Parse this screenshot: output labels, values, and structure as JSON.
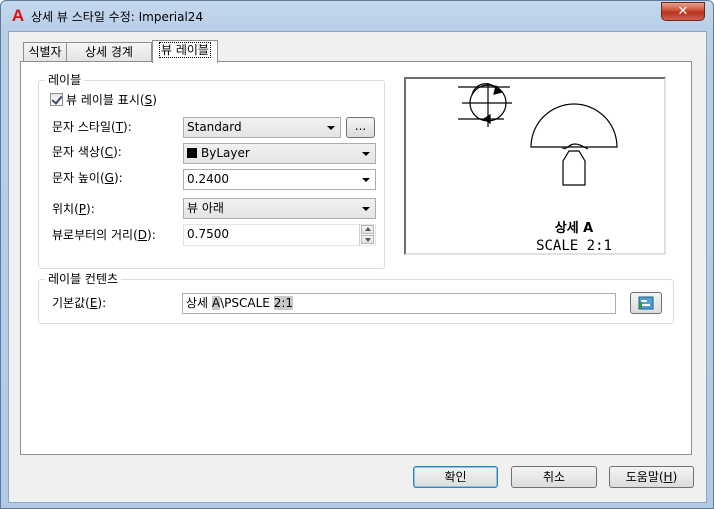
{
  "window": {
    "title": "상세 뷰 스타일 수정: Imperial24",
    "close_glyph": "✕"
  },
  "tabs": [
    {
      "label": "식별자",
      "active": false
    },
    {
      "label": "상세 경계",
      "active": false
    },
    {
      "label": "뷰 레이블",
      "active": true
    }
  ],
  "label_group": {
    "title": "레이블",
    "show_label": {
      "text": "뷰 레이블 표시(",
      "key": "S",
      "suffix": ")",
      "checked": true
    },
    "text_style": {
      "text": "문자 스타일(",
      "key": "T",
      "suffix": "):",
      "value": "Standard",
      "browse_label": "..."
    },
    "text_color": {
      "text": "문자 색상(",
      "key": "C",
      "suffix": "):",
      "value": "ByLayer"
    },
    "text_height": {
      "text": "문자 높이(",
      "key": "G",
      "suffix": "):",
      "value": "0.2400"
    },
    "location": {
      "text": "위치(",
      "key": "P",
      "suffix": "):",
      "value": "뷰 아래"
    },
    "distance": {
      "text": "뷰로부터의 거리(",
      "key": "D",
      "suffix": "):",
      "value": "0.7500"
    }
  },
  "preview": {
    "line1": "상세 A",
    "line2": "SCALE 2:1"
  },
  "content_group": {
    "title": "레이블 컨텐츠",
    "default_label": {
      "text": "기본값(",
      "key": "E",
      "suffix": "):"
    },
    "default_value_parts": [
      {
        "text": "상세 ",
        "highlight": false
      },
      {
        "text": "A",
        "highlight": true
      },
      {
        "text": "\\PSCALE ",
        "highlight": false
      },
      {
        "text": "2:1",
        "highlight": true
      }
    ]
  },
  "buttons": {
    "ok": "확인",
    "cancel": "취소",
    "help": {
      "text": "도움말(",
      "key": "H",
      "suffix": ")"
    }
  },
  "colors": {
    "titlebar": "#b8cfe8",
    "close": "#c9442c",
    "accent_border": "#3c7fb1"
  }
}
